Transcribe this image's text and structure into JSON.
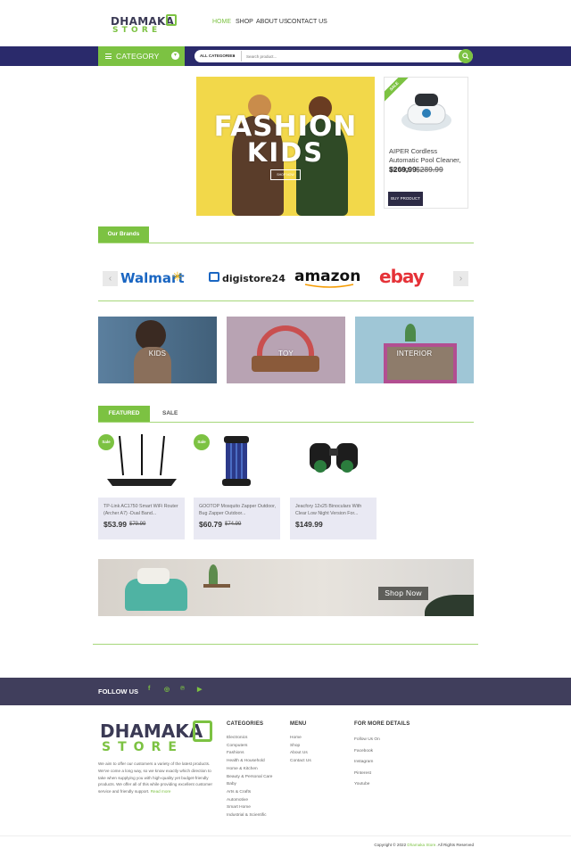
{
  "logo": {
    "line1": "DHAMAKA",
    "line2": "STORE"
  },
  "nav": {
    "items": [
      {
        "label": "HOME",
        "active": true
      },
      {
        "label": "SHOP",
        "active": false
      },
      {
        "label": "ABOUT US",
        "active": false
      },
      {
        "label": "CONTACT US",
        "active": false
      }
    ]
  },
  "category_button": {
    "label": "CATEGORY"
  },
  "search": {
    "category_select": "ALL CATEGORIES",
    "placeholder": "Search product..."
  },
  "hero": {
    "title_line1": "FASHION",
    "title_line2": "KIDS",
    "button": "SHOP NOW"
  },
  "sale_card": {
    "ribbon": "SALE",
    "title": "AIPER Cordless Automatic Pool Cleaner, Strong...",
    "price": "$269.99",
    "old_price": "$289.99",
    "button": "BUY PRODUCT"
  },
  "brands": {
    "tab": "Our Brands",
    "items": [
      "Walmart",
      "digistore24",
      "amazon",
      "ebay"
    ]
  },
  "categories": [
    {
      "label": "KIDS"
    },
    {
      "label": "TOY"
    },
    {
      "label": "INTERIOR"
    }
  ],
  "products": {
    "tabs": [
      "FEATURED",
      "SALE"
    ],
    "items": [
      {
        "badge": "Sale",
        "title": "TP-Link AC1750 Smart WiFi Router (Archer A7) -Dual Band...",
        "price": "$53.99",
        "old_price": "$79.99"
      },
      {
        "badge": "Sale",
        "title": "GOOTOP Mosquito Zapper Outdoor, Bug Zapper Outdoor...",
        "price": "$60.79",
        "old_price": "$74.99"
      },
      {
        "badge": "",
        "title": "Jeacfory 12x25 Binoculars With Clear Low Night Version For...",
        "price": "$149.99",
        "old_price": ""
      }
    ]
  },
  "banner": {
    "button": "Shop Now"
  },
  "footer": {
    "follow": "FOLLOW US",
    "social_icons": [
      "facebook-icon",
      "instagram-icon",
      "pinterest-icon",
      "youtube-icon"
    ],
    "about": "We aim to offer our customers a variety of the latest products. We've come a long way, so we know exactly which direction to take when supplying you with high-quality yet budget-friendly products. We offer all of this while providing excellent customer service and friendly support.",
    "read_more": "Read more",
    "categories_head": "CATEGORIES",
    "categories": [
      "Electronics",
      "Computers",
      "Fashions",
      "Health & Household",
      "Home & Kitchen",
      "Beauty & Personal Care",
      "Baby",
      "Arts & Crafts",
      "Automotive",
      "Smart Home",
      "Industrial & Scientific"
    ],
    "menu_head": "MENU",
    "menu": [
      "Home",
      "Shop",
      "About Us",
      "Contact Us"
    ],
    "details_head": "FOR MORE DETAILS",
    "details": [
      "Follow Us On",
      "Facebook",
      "Instagram",
      "Pinterest",
      "Youtube"
    ],
    "copyright_prefix": "Copyright © 2022",
    "copyright_brand": "Dhamaka Store.",
    "copyright_suffix": "All Rights Reserved"
  },
  "colors": {
    "accent": "#7cc242",
    "navbar": "#2a2a6b",
    "footer": "#403e5c"
  }
}
